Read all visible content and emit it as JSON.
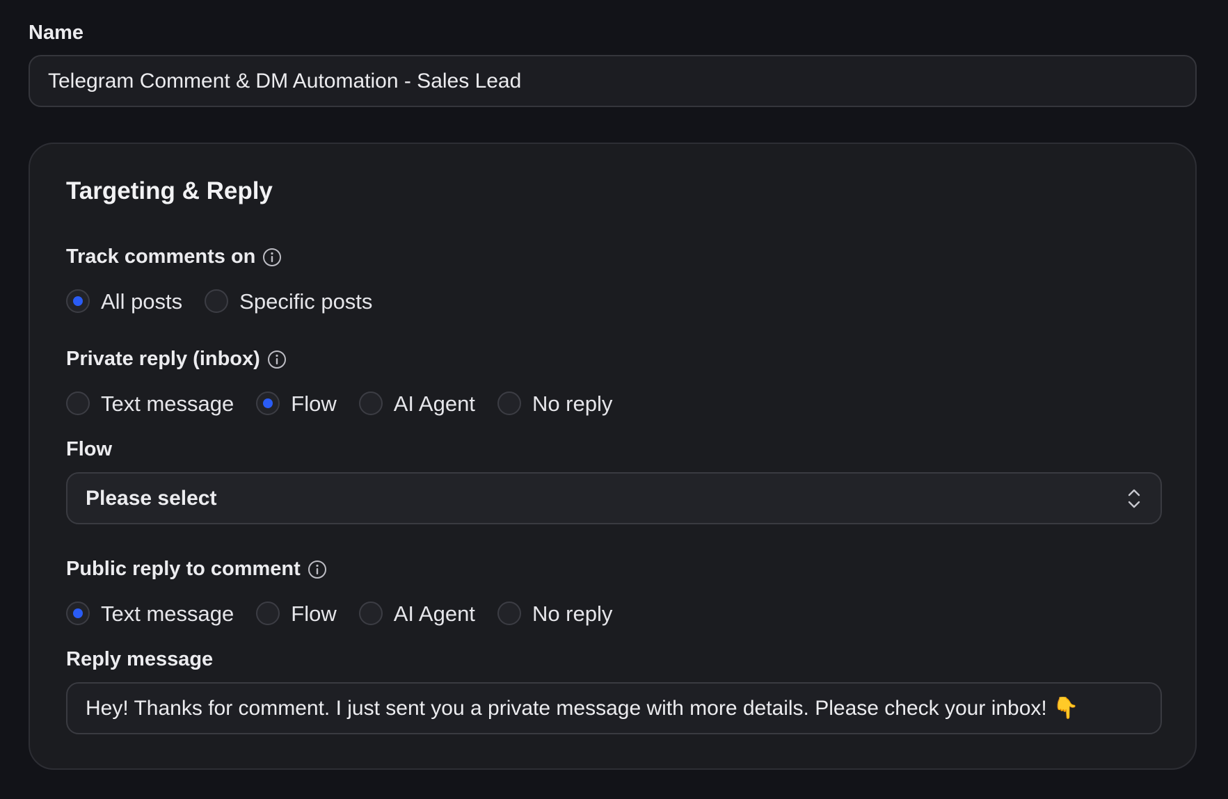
{
  "name_field": {
    "label": "Name",
    "value": "Telegram Comment & DM Automation - Sales Lead"
  },
  "card": {
    "title": "Targeting & Reply",
    "track_comments": {
      "label": "Track comments on",
      "options": [
        {
          "label": "All posts",
          "selected": true
        },
        {
          "label": "Specific posts",
          "selected": false
        }
      ]
    },
    "private_reply": {
      "label": "Private reply (inbox)",
      "options": [
        {
          "label": "Text message",
          "selected": false
        },
        {
          "label": "Flow",
          "selected": true
        },
        {
          "label": "AI Agent",
          "selected": false
        },
        {
          "label": "No reply",
          "selected": false
        }
      ]
    },
    "flow": {
      "label": "Flow",
      "selected_value": "Please select"
    },
    "public_reply": {
      "label": "Public reply to comment",
      "options": [
        {
          "label": "Text message",
          "selected": true
        },
        {
          "label": "Flow",
          "selected": false
        },
        {
          "label": "AI Agent",
          "selected": false
        },
        {
          "label": "No reply",
          "selected": false
        }
      ]
    },
    "reply_message": {
      "label": "Reply message",
      "value": "Hey! Thanks for comment. I just sent you a private message with more details. Please check your inbox! 👇"
    }
  },
  "colors": {
    "background": "#121318",
    "card": "#1b1c20",
    "accent": "#2a5cf5"
  }
}
